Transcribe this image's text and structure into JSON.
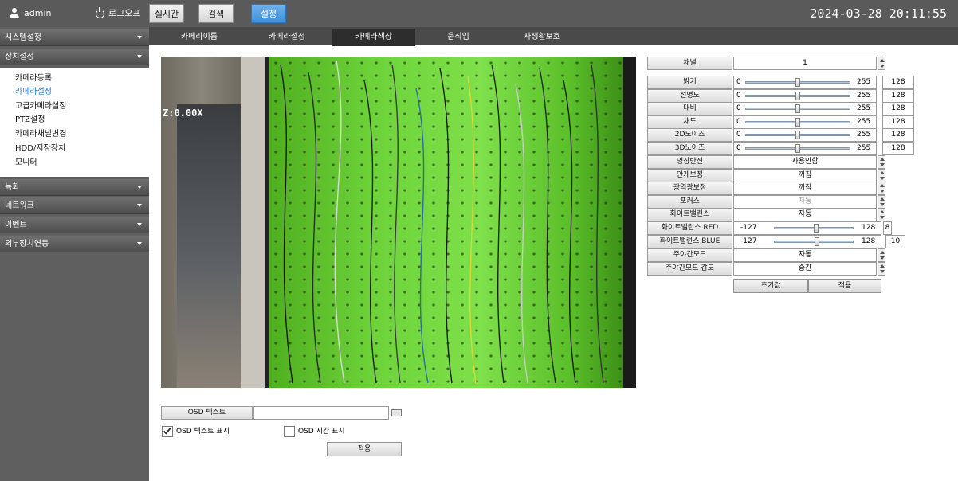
{
  "topbar": {
    "username": "admin",
    "logout_label": "로그오프",
    "nav_buttons": [
      "실시간",
      "검색",
      "설정"
    ],
    "active_nav": "설정",
    "datetime": "2024-03-28 20:11:55",
    "colors": {
      "bar": "#5a5a5a",
      "active": "#4a9be6"
    }
  },
  "sidebar": {
    "sections": [
      "시스템설정",
      "장치설정",
      "녹화",
      "네트워크",
      "이벤트",
      "외부장치연동"
    ],
    "device_items": [
      "카메라등록",
      "카메라설정",
      "고급카메라설정",
      "PTZ설정",
      "카메라채널변경",
      "HDD/저장장치",
      "모니터"
    ],
    "active_item": "카메라설정"
  },
  "tabs": {
    "items": [
      "카메라이름",
      "카메라설정",
      "카메라색상",
      "움직임",
      "사생활보호"
    ],
    "active": "카메라색상"
  },
  "video": {
    "zoom_text": "Z:0.00X"
  },
  "settings": {
    "channel": {
      "label": "채널",
      "value": "1"
    },
    "sliders": [
      {
        "label": "밝기",
        "min": "0",
        "max": "255",
        "value": "128",
        "level": 0.5
      },
      {
        "label": "선명도",
        "min": "0",
        "max": "255",
        "value": "128",
        "level": 0.5
      },
      {
        "label": "대비",
        "min": "0",
        "max": "255",
        "value": "128",
        "level": 0.5
      },
      {
        "label": "채도",
        "min": "0",
        "max": "255",
        "value": "128",
        "level": 0.5
      },
      {
        "label": "2D노이즈",
        "min": "0",
        "max": "255",
        "value": "128",
        "level": 0.5
      },
      {
        "label": "3D노이즈",
        "min": "0",
        "max": "255",
        "value": "128",
        "level": 0.5
      }
    ],
    "selects": [
      {
        "label": "영상반전",
        "value": "사용안함",
        "disabled": false
      },
      {
        "label": "안개보정",
        "value": "꺼짐",
        "disabled": false
      },
      {
        "label": "광역광보정",
        "value": "꺼짐",
        "disabled": false
      },
      {
        "label": "포커스",
        "value": "자동",
        "disabled": true
      },
      {
        "label": "화이트밸런스",
        "value": "자동",
        "disabled": false
      }
    ],
    "wb_sliders": [
      {
        "label": "화이트밸런스 RED",
        "min": "-127",
        "max": "128",
        "value": "8",
        "level": 0.53
      },
      {
        "label": "화이트밸런스 BLUE",
        "min": "-127",
        "max": "128",
        "value": "10",
        "level": 0.54
      }
    ],
    "selects2": [
      {
        "label": "주야간모드",
        "value": "자동",
        "disabled": false
      },
      {
        "label": "주야간모드 감도",
        "value": "중간",
        "disabled": false
      }
    ],
    "reset_label": "초기값",
    "apply_label": "적용"
  },
  "osd": {
    "text_label": "OSD 텍스트",
    "text_value": "",
    "show_text_label": "OSD 텍스트 표시",
    "show_text_checked": true,
    "show_time_label": "OSD 시간 표시",
    "show_time_checked": false,
    "apply_label": "적용"
  }
}
